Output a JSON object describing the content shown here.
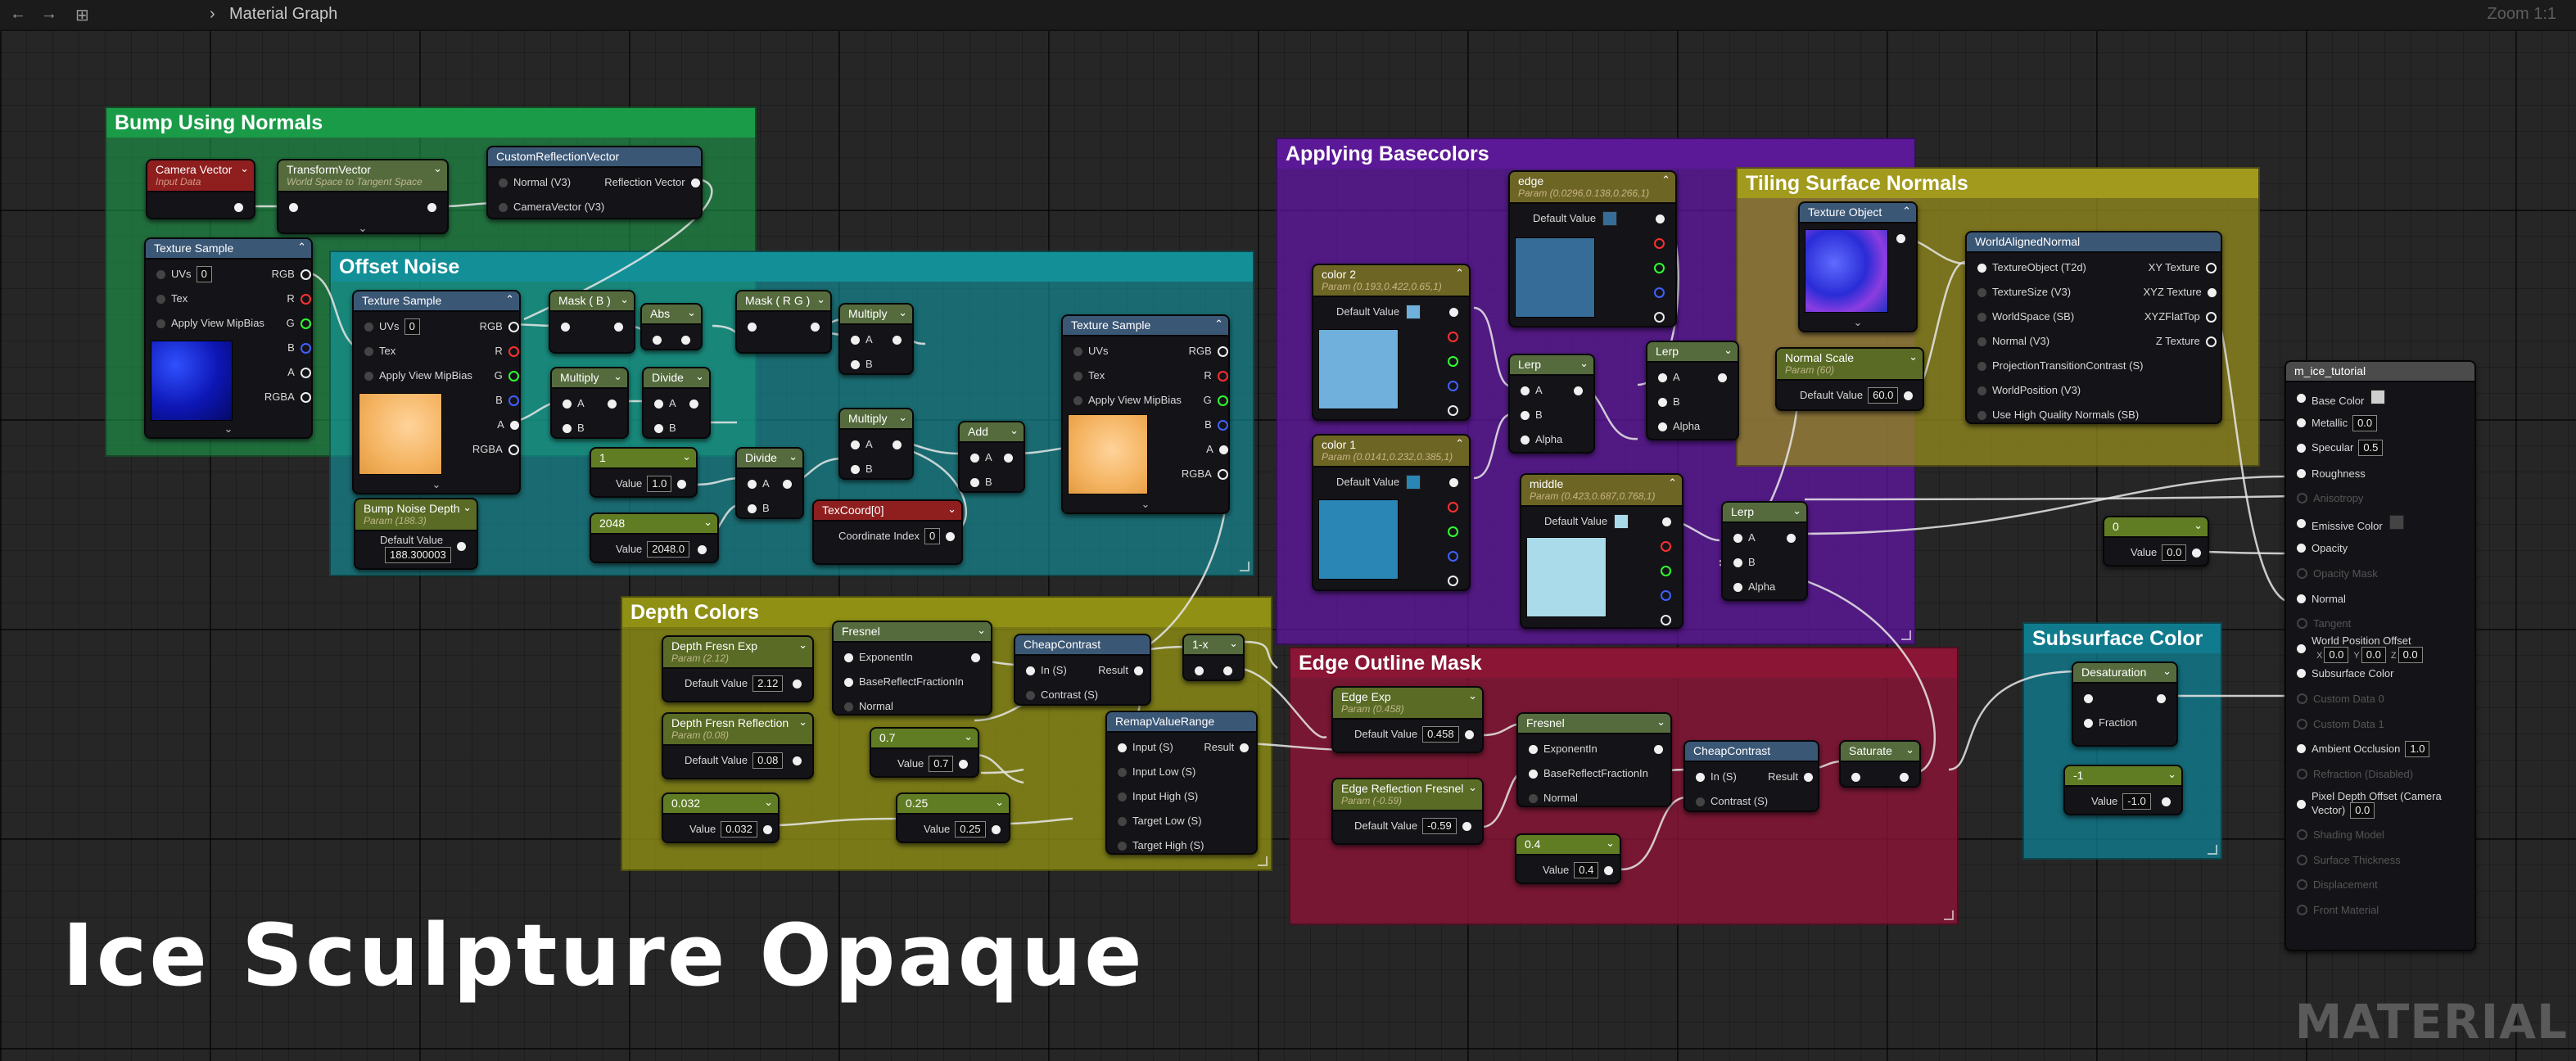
{
  "breadcrumb": {
    "title": "Material Graph"
  },
  "zoom": "Zoom 1:1",
  "bigtitle": "Ice Sculpture Opaque",
  "watermark": "MATERIAL",
  "colors": {
    "comment_bump": "#1a9b48",
    "comment_offset": "#138f98",
    "comment_base": "#5b1897",
    "comment_tiling": "#8c8419",
    "comment_depth": "#8f9014",
    "comment_edge": "#8a1535",
    "comment_sss": "#0f7b8c",
    "header_param": "#596b25",
    "header_func": "#3b5776",
    "header_red": "#8f1e1e",
    "header_const": "#617d24"
  },
  "comments": {
    "bump": "Bump Using Normals",
    "offset": "Offset Noise",
    "base": "Applying Basecolors",
    "tiling": "Tiling Surface Normals",
    "depth": "Depth Colors",
    "edge": "Edge Outline Mask",
    "sss": "Subsurface Color"
  },
  "labels": {
    "uvs": "UVs",
    "tex": "Tex",
    "mip": "Apply View MipBias",
    "rgb": "RGB",
    "r": "R",
    "g": "G",
    "b": "B",
    "a": "A",
    "rgba": "RGBA",
    "pa": "A",
    "pb": "B",
    "alpha": "Alpha",
    "value": "Value",
    "default_value": "Default Value",
    "normal_v3": "Normal (V3)",
    "refl_vec": "Reflection Vector",
    "camvec_v3": "CameraVector (V3)",
    "coord_index": "Coordinate Index",
    "exp_in": "ExponentIn",
    "brfi": "BaseReflectFractionIn",
    "normal": "Normal",
    "in_s": "In (S)",
    "contrast_s": "Contrast (S)",
    "result": "Result",
    "input_s": "Input (S)",
    "input_low": "Input Low (S)",
    "input_high": "Input High (S)",
    "target_low": "Target Low (S)",
    "target_high": "Target High (S)",
    "fraction": "Fraction",
    "to_t2d": "TextureObject (T2d)",
    "texsize": "TextureSize (V3)",
    "worldspace": "WorldSpace (SB)",
    "normal_v3b": "Normal (V3)",
    "ptc": "ProjectionTransitionContrast (S)",
    "worldpos": "WorldPosition (V3)",
    "hqn": "Use High Quality Normals (SB)",
    "xy": "XY Texture",
    "xyz": "XYZ Texture",
    "xyzflat": "XYZFlatTop",
    "z": "Z Texture"
  },
  "nodes": {
    "camvec": {
      "title": "Camera Vector",
      "sub": "Input Data"
    },
    "transform": {
      "title": "TransformVector",
      "sub": "World Space to Tangent Space"
    },
    "customrefl": {
      "title": "CustomReflectionVector"
    },
    "ts_bump": {
      "title": "Texture Sample",
      "uvs": "0"
    },
    "ts_offset": {
      "title": "Texture Sample",
      "uvs": "0"
    },
    "mask_b": {
      "title": "Mask ( B )"
    },
    "abs": {
      "title": "Abs"
    },
    "mask_rg": {
      "title": "Mask ( R G )"
    },
    "multiply1": {
      "title": "Multiply"
    },
    "multiply2": {
      "title": "Multiply"
    },
    "divide1": {
      "title": "Divide"
    },
    "multiply3": {
      "title": "Multiply"
    },
    "add": {
      "title": "Add"
    },
    "divide2": {
      "title": "Divide"
    },
    "const1": {
      "title": "1",
      "value": "1.0"
    },
    "const2048": {
      "title": "2048",
      "value": "2048.0"
    },
    "texcoord": {
      "title": "TexCoord[0]",
      "index": "0"
    },
    "bumpdepth": {
      "title": "Bump Noise Depth",
      "sub": "Param (188.3)",
      "value": "188.300003"
    },
    "ts_right": {
      "title": "Texture Sample"
    },
    "color2": {
      "title": "color 2",
      "sub": "Param (0.193,0.422,0.65,1)",
      "swatch": "#6fb0dc"
    },
    "color1": {
      "title": "color 1",
      "sub": "Param (0.0141,0.232,0.385,1)",
      "swatch": "#2a86b5"
    },
    "edge": {
      "title": "edge",
      "sub": "Param (0.0296,0.138,0.266,1)",
      "swatch": "#366d98"
    },
    "middle": {
      "title": "middle",
      "sub": "Param (0.423,0.687,0.768,1)",
      "swatch": "#a9dbea"
    },
    "lerp1": {
      "title": "Lerp"
    },
    "lerp2": {
      "title": "Lerp"
    },
    "lerp3": {
      "title": "Lerp"
    },
    "texobj": {
      "title": "Texture Object"
    },
    "normalscale": {
      "title": "Normal Scale",
      "sub": "Param (60)",
      "value": "60.0"
    },
    "worldaligned": {
      "title": "WorldAlignedNormal"
    },
    "fresnel_depth": {
      "title": "Fresnel"
    },
    "cheap1": {
      "title": "CheapContrast"
    },
    "oneminus": {
      "title": "1-x"
    },
    "remap": {
      "title": "RemapValueRange"
    },
    "depthexp": {
      "title": "Depth Fresn Exp",
      "sub": "Param (2.12)",
      "value": "2.12"
    },
    "depthrefl": {
      "title": "Depth Fresn Reflection",
      "sub": "Param (0.08)",
      "value": "0.08"
    },
    "c07": {
      "title": "0.7",
      "value": "0.7"
    },
    "c0032": {
      "title": "0.032",
      "value": "0.032"
    },
    "c025": {
      "title": "0.25",
      "value": "0.25"
    },
    "edgeexp": {
      "title": "Edge Exp",
      "sub": "Param (0.458)",
      "value": "0.458"
    },
    "edgerefl": {
      "title": "Edge Reflection Fresnel",
      "sub": "Param (-0.59)",
      "value": "-0.59"
    },
    "fresnel_edge": {
      "title": "Fresnel"
    },
    "c04": {
      "title": "0.4",
      "value": "0.4"
    },
    "cheap2": {
      "title": "CheapContrast"
    },
    "saturate": {
      "title": "Saturate"
    },
    "c0": {
      "title": "0",
      "value": "0.0"
    },
    "desat": {
      "title": "Desaturation"
    },
    "cm1": {
      "title": "-1",
      "value": "-1.0"
    }
  },
  "material": {
    "title": "m_ice_tutorial",
    "pins": [
      {
        "label": "Base Color",
        "box": "",
        "swatch": "#cfcfcf",
        "enabled": true
      },
      {
        "label": "Metallic",
        "box": "0.0",
        "enabled": true
      },
      {
        "label": "Specular",
        "box": "0.5",
        "enabled": true
      },
      {
        "label": "Roughness",
        "enabled": true
      },
      {
        "label": "Anisotropy",
        "enabled": false
      },
      {
        "label": "Emissive Color",
        "swatch": "#444",
        "enabled": true
      },
      {
        "label": "Opacity",
        "enabled": true
      },
      {
        "label": "Opacity Mask",
        "enabled": false
      },
      {
        "label": "Normal",
        "enabled": true
      },
      {
        "label": "Tangent",
        "enabled": false
      },
      {
        "label": "World Position Offset",
        "xyz": [
          "0.0",
          "0.0",
          "0.0"
        ],
        "enabled": true
      },
      {
        "label": "Subsurface Color",
        "enabled": true
      },
      {
        "label": "Custom Data 0",
        "enabled": false
      },
      {
        "label": "Custom Data 1",
        "enabled": false
      },
      {
        "label": "Ambient Occlusion",
        "box": "1.0",
        "enabled": true
      },
      {
        "label": "Refraction (Disabled)",
        "enabled": false
      },
      {
        "label": "Pixel Depth Offset (Camera Vector)",
        "box": "0.0",
        "enabled": true
      },
      {
        "label": "Shading Model",
        "enabled": false
      },
      {
        "label": "Surface Thickness",
        "enabled": false
      },
      {
        "label": "Displacement",
        "enabled": false
      },
      {
        "label": "Front Material",
        "enabled": false
      }
    ]
  }
}
